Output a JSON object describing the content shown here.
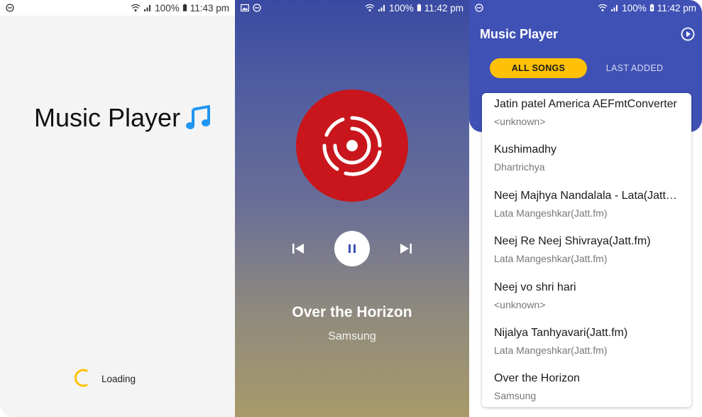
{
  "status_bars": [
    {
      "battery": "100%",
      "time": "11:43 pm"
    },
    {
      "battery": "100%",
      "time": "11:42 pm"
    },
    {
      "battery": "100%",
      "time": "11:42 pm"
    }
  ],
  "splash": {
    "title": "Music Player",
    "loading_text": "Loading",
    "icon": "music-note-icon",
    "accent": "#2196f3",
    "spinner_color": "#ffc107"
  },
  "now_playing": {
    "title": "Over the Horizon",
    "artist": "Samsung",
    "state": "playing",
    "album_art_color": "#c8161c",
    "controls": {
      "previous": "skip-previous-icon",
      "play_pause": "pause-icon",
      "next": "skip-next-icon"
    }
  },
  "library": {
    "app_title": "Music Player",
    "header_color": "#3f51b5",
    "tabs": [
      {
        "label": "ALL SONGS",
        "active": true,
        "color": "#ffc107"
      },
      {
        "label": "LAST ADDED",
        "active": false
      }
    ],
    "songs": [
      {
        "title": "Jatin patel America AEFmtConverter",
        "artist": "<unknown>"
      },
      {
        "title": "Kushimadhy",
        "artist": "Dhartrichya"
      },
      {
        "title": "Neej Majhya Nandalala - Lata(Jatt.fm)",
        "artist": "Lata Mangeshkar(Jatt.fm)"
      },
      {
        "title": "Neej Re Neej Shivraya(Jatt.fm)",
        "artist": "Lata Mangeshkar(Jatt.fm)"
      },
      {
        "title": "Neej vo shri hari",
        "artist": "<unknown>"
      },
      {
        "title": "Nijalya Tanhyavari(Jatt.fm)",
        "artist": "Lata Mangeshkar(Jatt.fm)"
      },
      {
        "title": "Over the Horizon",
        "artist": "Samsung"
      }
    ]
  }
}
